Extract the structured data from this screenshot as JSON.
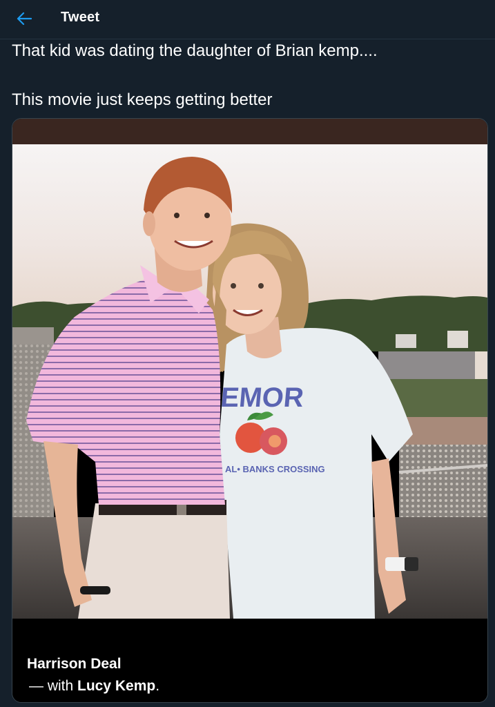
{
  "header": {
    "back_icon": "arrow-left-icon",
    "title": "Tweet",
    "accent": "#1d9bf0"
  },
  "tweet": {
    "line1": "That kid was dating the daughter of Brian kemp....",
    "line2": "This movie just keeps getting better"
  },
  "media": {
    "shirt_text_top": "AEMOR",
    "shirt_text_bottom": "AL• BANKS CROSSING",
    "caption_name": "Harrison Deal",
    "caption_prefix": "— with ",
    "caption_tagged": "Lucy Kemp",
    "caption_suffix": "."
  },
  "colors": {
    "background": "#15202b",
    "text": "#ffffff"
  }
}
